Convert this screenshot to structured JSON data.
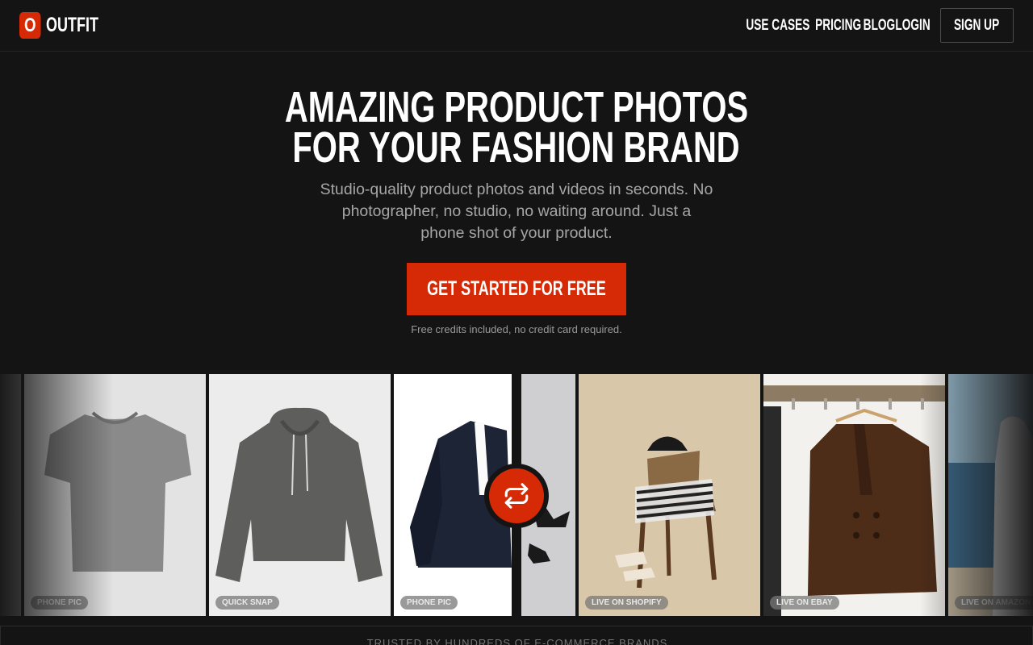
{
  "brand": {
    "logo_letter": "O",
    "name": "OUTFIT",
    "accent_color": "#d62a06"
  },
  "nav": {
    "links": [
      "USE CASES",
      "PRICING",
      "BLOG",
      "LOGIN"
    ],
    "signup_label": "SIGN UP"
  },
  "hero": {
    "title_line1": "AMAZING PRODUCT PHOTOS",
    "title_line2": "FOR YOUR FASHION BRAND",
    "subtitle": "Studio-quality product photos and videos in seconds. No photographer, no studio, no waiting around. Just a phone shot of your product.",
    "cta_label": "GET STARTED FOR FREE",
    "cta_note": "Free credits included, no credit card required."
  },
  "gallery": {
    "tiles": [
      {
        "badge": "PHONE PIC",
        "subject": "grey t-shirt"
      },
      {
        "badge": "QUICK SNAP",
        "subject": "grey hoodie"
      },
      {
        "badge": "PHONE PIC",
        "subject": "navy pinstripe blazer"
      },
      {
        "badge": "LIVE ON SHOPIFY",
        "subject": "chair with striped shirt and hat"
      },
      {
        "badge": "LIVE ON EBAY",
        "subject": "brown double-breasted blazer on hanger"
      },
      {
        "badge": "LIVE ON AMAZON",
        "subject": "model at the beach"
      }
    ],
    "swap_icon": "swap-arrows-icon"
  },
  "trusted": {
    "text": "TRUSTED BY HUNDREDS OF E-COMMERCE BRANDS"
  }
}
